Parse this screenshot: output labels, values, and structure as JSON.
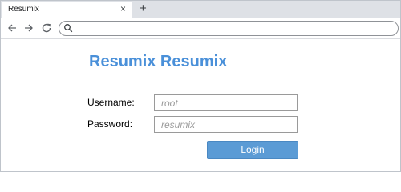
{
  "browser": {
    "tab_title": "Resumix",
    "tab_close_glyph": "×",
    "new_tab_glyph": "+",
    "address_value": ""
  },
  "login": {
    "title": "Resumix Resumix",
    "username_label": "Username:",
    "username_placeholder": "root",
    "password_label": "Password:",
    "password_placeholder": "resumix",
    "login_button": "Login"
  },
  "colors": {
    "title": "#4a90d9",
    "button": "#5b9bd5",
    "tabstrip": "#dee1e6"
  }
}
